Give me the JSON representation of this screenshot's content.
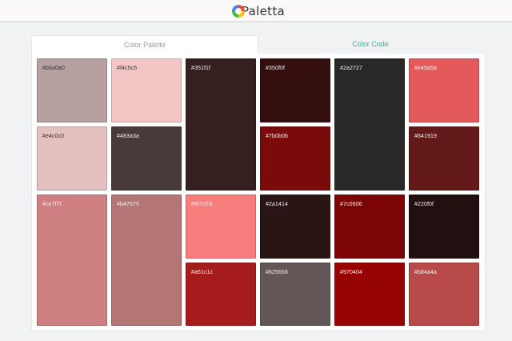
{
  "header": {
    "logo_text": "Paletta"
  },
  "tabs": {
    "palette": "Color Palette",
    "code": "Color Code"
  },
  "swatches": [
    {
      "hex": "#b6a0a0",
      "label": "#b6a0a0",
      "text": "dark"
    },
    {
      "hex": "#f4c5c5",
      "label": "#f4c5c5",
      "text": "dark"
    },
    {
      "hex": "#351f1f",
      "label": "#351f1f",
      "text": "light"
    },
    {
      "hex": "#350f0f",
      "label": "#350f0f",
      "text": "light"
    },
    {
      "hex": "#2a2727",
      "label": "#2a2727",
      "text": "light"
    },
    {
      "hex": "#e45a5a",
      "label": "#e45a5a",
      "text": "light"
    },
    {
      "hex": "#e4c0c0",
      "label": "#e4c0c0",
      "text": "dark"
    },
    {
      "hex": "#483a3a",
      "label": "#483a3a",
      "text": "light"
    },
    {
      "hex": "#7b0b0b",
      "label": "#7b0b0b",
      "text": "light"
    },
    {
      "hex": "#641919",
      "label": "#641919",
      "text": "light"
    },
    {
      "hex": "#ce7f7f",
      "label": "#ce7f7f",
      "text": "light"
    },
    {
      "hex": "#b47575",
      "label": "#b47575",
      "text": "light"
    },
    {
      "hex": "#f87d7d",
      "label": "#f87d7d",
      "text": "light"
    },
    {
      "hex": "#2a1414",
      "label": "#2a1414",
      "text": "light"
    },
    {
      "hex": "#7c0606",
      "label": "#7c0606",
      "text": "light"
    },
    {
      "hex": "#220f0f",
      "label": "#220f0f",
      "text": "light"
    },
    {
      "hex": "#a61c1c",
      "label": "#a61c1c",
      "text": "light"
    },
    {
      "hex": "#625656",
      "label": "#625656",
      "text": "light"
    },
    {
      "hex": "#970404",
      "label": "#970404",
      "text": "light"
    },
    {
      "hex": "#b84a4a",
      "label": "#b84a4a",
      "text": "light"
    }
  ]
}
